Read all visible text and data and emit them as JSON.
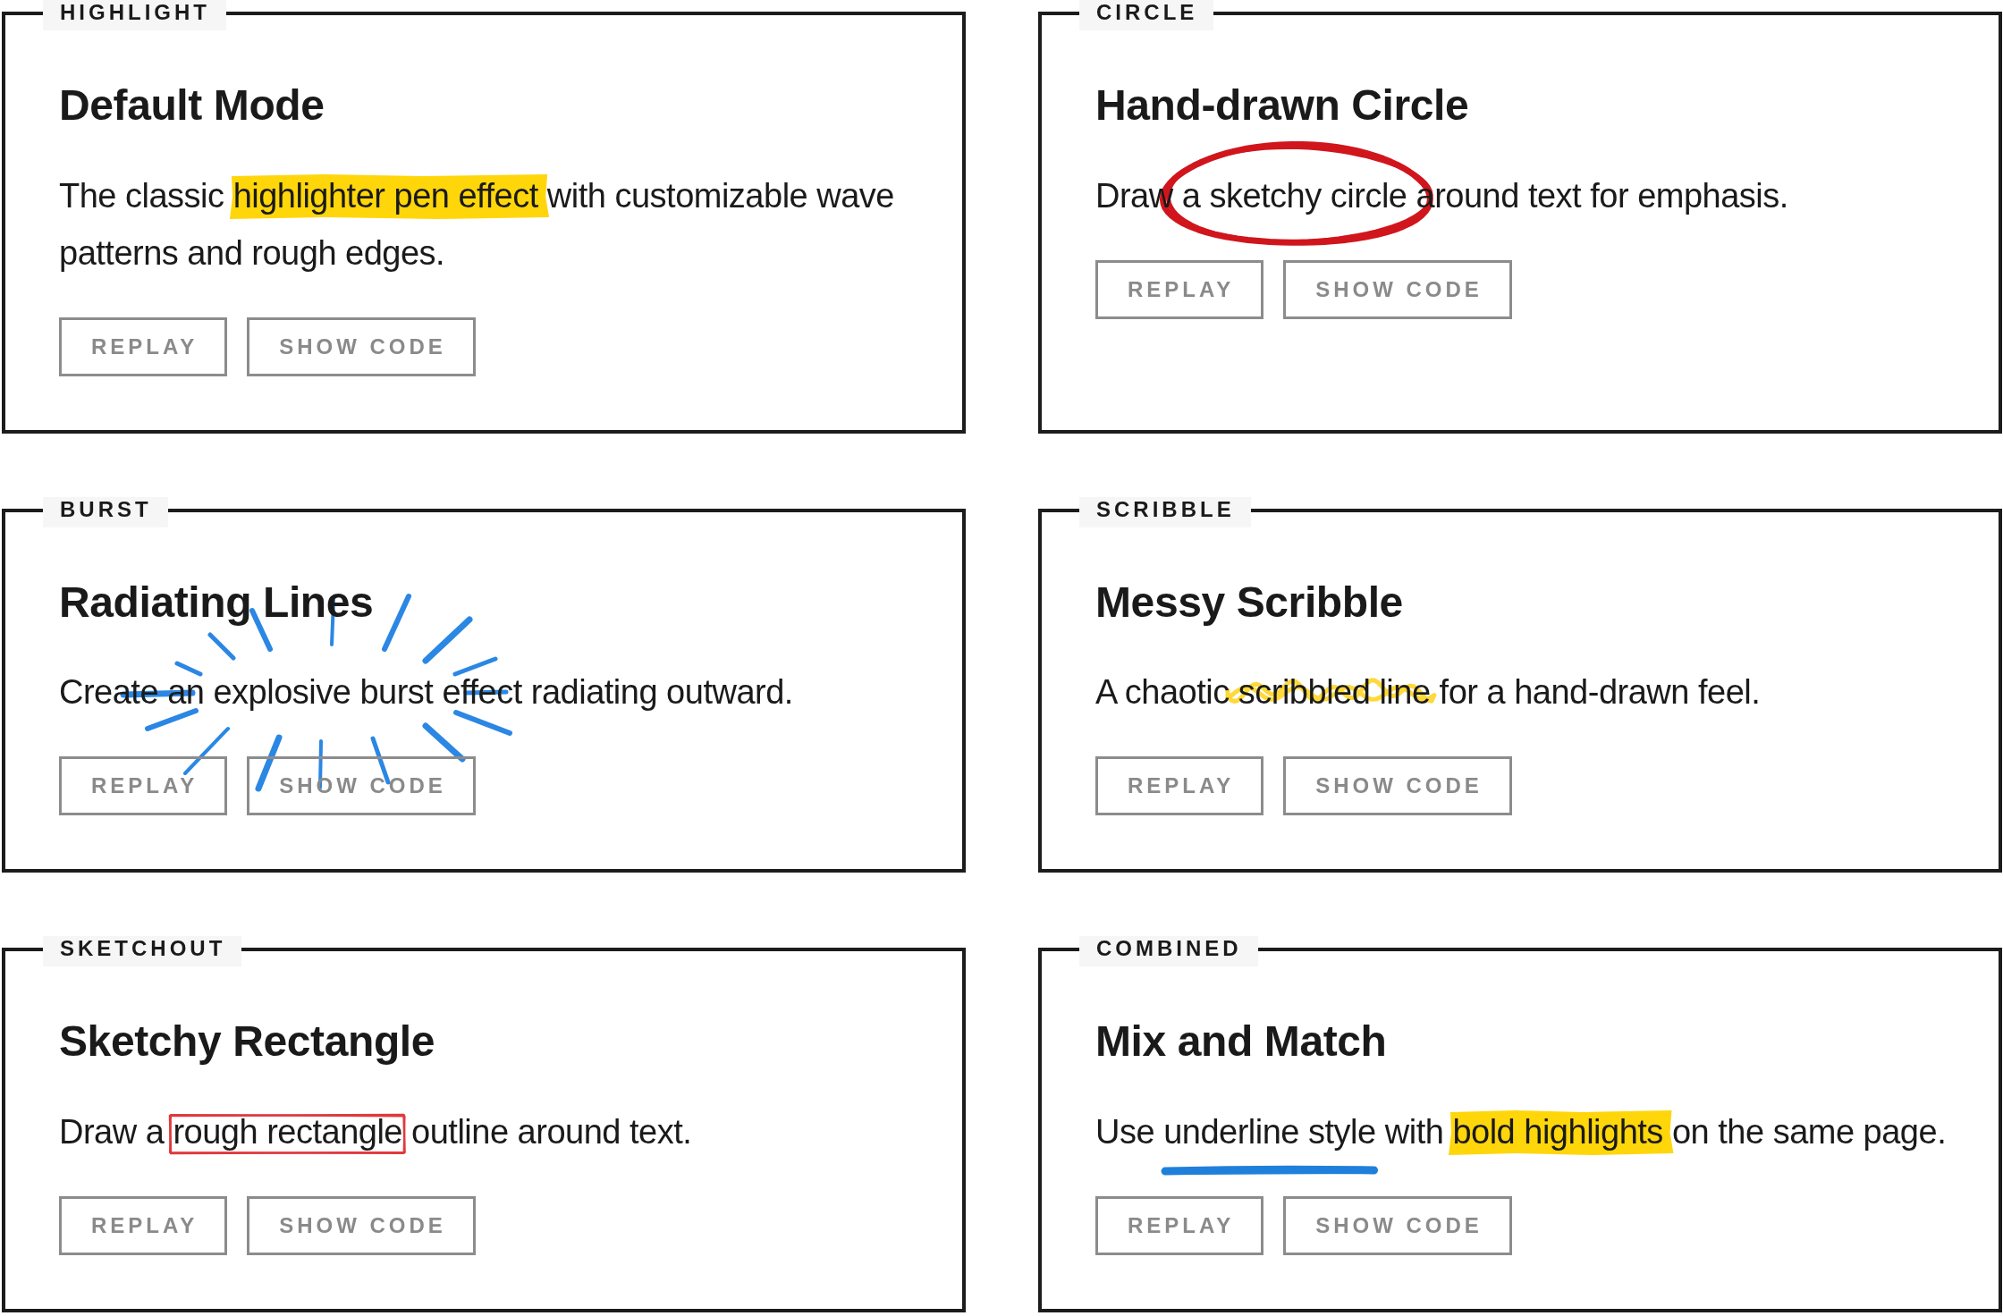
{
  "cards": [
    {
      "label": "HIGHLIGHT",
      "title": "Default Mode",
      "description": [
        {
          "kind": "plain",
          "text": "The classic "
        },
        {
          "kind": "highlight",
          "text": "highlighter pen effect",
          "color": "#ffd60a"
        },
        {
          "kind": "plain",
          "text": " with customizable wave patterns and rough edges."
        }
      ],
      "buttons": [
        "REPLAY",
        "SHOW CODE"
      ]
    },
    {
      "label": "CIRCLE",
      "title": "Hand-drawn Circle",
      "description": [
        {
          "kind": "plain",
          "text": "Draw "
        },
        {
          "kind": "circle",
          "text": "a sketchy circle",
          "color": "#d0161c"
        },
        {
          "kind": "plain",
          "text": " around text for emphasis."
        }
      ],
      "buttons": [
        "REPLAY",
        "SHOW CODE"
      ]
    },
    {
      "label": "BURST",
      "title": "Radiating Lines",
      "description": [
        {
          "kind": "plain",
          "text": "Create "
        },
        {
          "kind": "burst",
          "text": "an explosive burst",
          "color": "#2b87e3"
        },
        {
          "kind": "plain",
          "text": " effect radiating outward."
        }
      ],
      "buttons": [
        "REPLAY",
        "SHOW CODE"
      ]
    },
    {
      "label": "SCRIBBLE",
      "title": "Messy Scribble",
      "description": [
        {
          "kind": "plain",
          "text": "A chaotic "
        },
        {
          "kind": "scribble",
          "text": "scribbled line",
          "color": "#ffd83a"
        },
        {
          "kind": "plain",
          "text": " for a hand-drawn feel."
        }
      ],
      "buttons": [
        "REPLAY",
        "SHOW CODE"
      ]
    },
    {
      "label": "SKETCHOUT",
      "title": "Sketchy Rectangle",
      "description": [
        {
          "kind": "plain",
          "text": "Draw a "
        },
        {
          "kind": "rectangle",
          "text": "rough rectangle",
          "color": "#e0393e"
        },
        {
          "kind": "plain",
          "text": " outline around text."
        }
      ],
      "buttons": [
        "REPLAY",
        "SHOW CODE"
      ]
    },
    {
      "label": "COMBINED",
      "title": "Mix and Match",
      "description": [
        {
          "kind": "plain",
          "text": "Use "
        },
        {
          "kind": "underline",
          "text": "underline style",
          "color": "#1f80db"
        },
        {
          "kind": "plain",
          "text": " with "
        },
        {
          "kind": "highlight",
          "text": "bold highlights",
          "color": "#ffd60a"
        },
        {
          "kind": "plain",
          "text": " on the same page."
        }
      ],
      "buttons": [
        "REPLAY",
        "SHOW CODE"
      ]
    }
  ]
}
